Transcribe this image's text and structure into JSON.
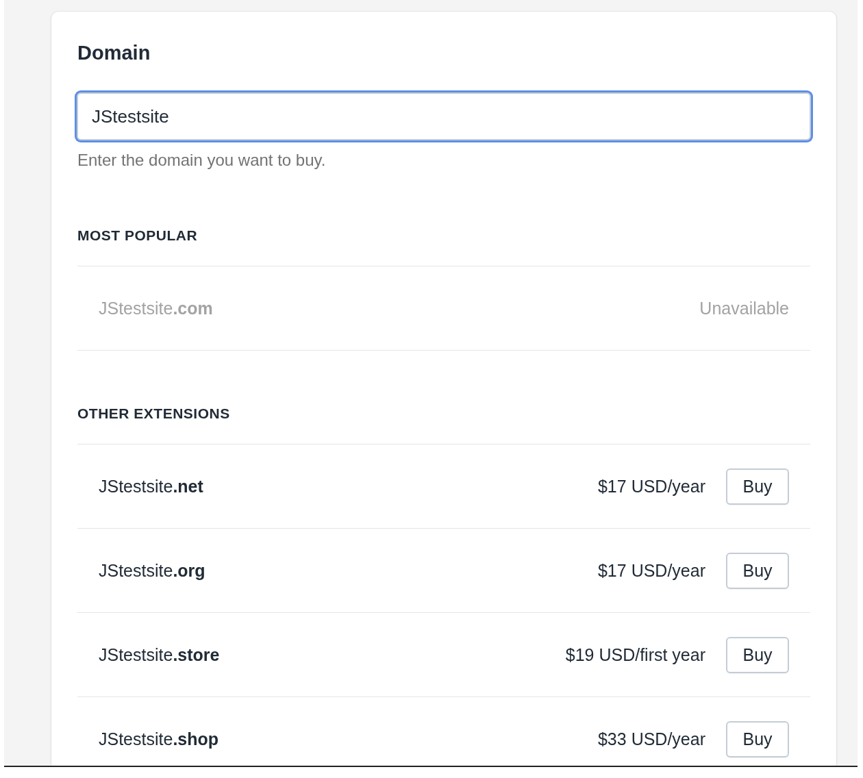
{
  "title": "Domain",
  "domain_field": {
    "value": "JStestsite",
    "focused": true
  },
  "help_text": "Enter the domain you want to buy.",
  "sections": [
    {
      "heading": "MOST POPULAR",
      "rows": [
        {
          "domain": "JStestsite**.com**",
          "available": false,
          "status": "Unavailable"
        }
      ]
    },
    {
      "heading": "OTHER EXTENSIONS",
      "rows": [
        {
          "domain": "JStestsite**.net**",
          "available": true,
          "price": "$17 USD/year",
          "button": "Buy"
        },
        {
          "domain": "JStestsite**.org**",
          "available": true,
          "price": "$17 USD/year",
          "button": "Buy"
        },
        {
          "domain": "JStestsite**.store**",
          "available": true,
          "price": "$19 USD/first year",
          "button": "Buy"
        },
        {
          "domain": "JStestsite**.shop**",
          "available": true,
          "price": "$33 USD/year",
          "button": "Buy"
        }
      ]
    }
  ]
}
